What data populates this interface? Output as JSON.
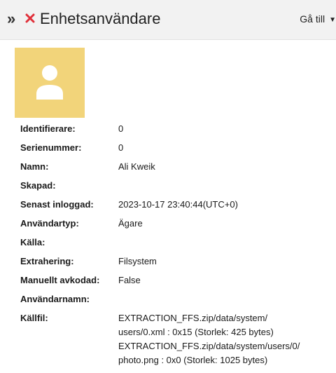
{
  "header": {
    "title": "Enhetsanvändare",
    "goto_label": "Gå till"
  },
  "colors": {
    "avatar_bg": "#f2d47a",
    "close_icon": "#e0303a"
  },
  "properties": [
    {
      "label": "Identifierare:",
      "value": "0"
    },
    {
      "label": "Serienummer:",
      "value": "0"
    },
    {
      "label": "Namn:",
      "value": "Ali Kweik"
    },
    {
      "label": "Skapad:",
      "value": ""
    },
    {
      "label": "Senast inloggad:",
      "value": "2023-10-17 23:40:44(UTC+0)"
    },
    {
      "label": "Användartyp:",
      "value": "Ägare"
    },
    {
      "label": "Källa:",
      "value": ""
    },
    {
      "label": "Extrahering:",
      "value": "Filsystem"
    },
    {
      "label": "Manuellt avkodad:",
      "value": "False"
    },
    {
      "label": "Användarnamn:",
      "value": ""
    }
  ],
  "source_file": {
    "label": "Källfil:",
    "lines": [
      "EXTRACTION_FFS.zip/data/system/",
      "users/0.xml : 0x15 (Storlek: 425 bytes)",
      "EXTRACTION_FFS.zip/data/system/users/0/",
      "photo.png : 0x0 (Storlek: 1025 bytes)"
    ]
  }
}
